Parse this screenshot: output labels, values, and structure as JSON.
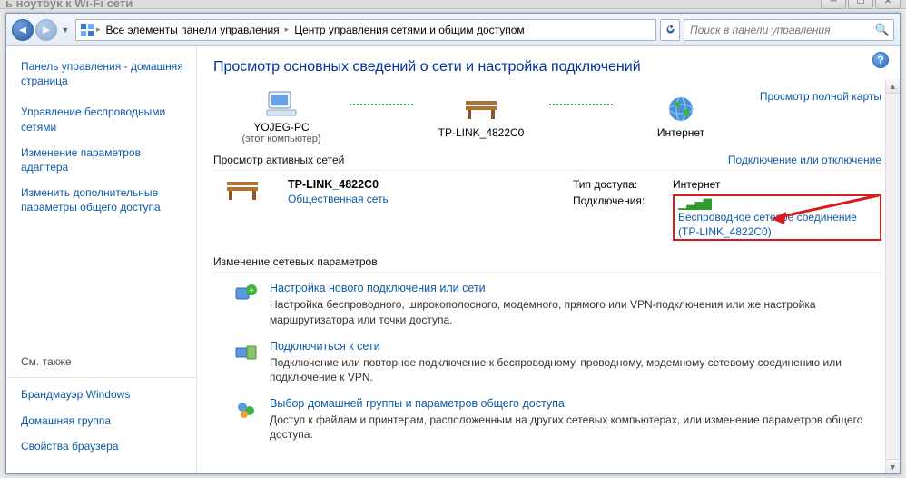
{
  "outer": {
    "partial_title": "ь ноутбук к Wi-Fi сети"
  },
  "addrbar": {
    "bc1": "Все элементы панели управления",
    "bc2": "Центр управления сетями и общим доступом",
    "search_placeholder": "Поиск в панели управления"
  },
  "sidebar": {
    "home": "Панель управления - домашняя страница",
    "items": [
      "Управление беспроводными сетями",
      "Изменение параметров адаптера",
      "Изменить дополнительные параметры общего доступа"
    ],
    "see_also": "См. также",
    "refs": [
      "Брандмауэр Windows",
      "Домашняя группа",
      "Свойства браузера"
    ]
  },
  "content": {
    "heading": "Просмотр основных сведений о сети и настройка подключений",
    "view_map": "Просмотр полной карты",
    "map_nodes": {
      "pc": "YOJEG-PC",
      "pc_sub": "(этот компьютер)",
      "router": "TP-LINK_4822C0",
      "internet": "Интернет"
    },
    "active_title": "Просмотр активных сетей",
    "active_link": "Подключение или отключение",
    "net_name": "TP-LINK_4822C0",
    "net_type": "Общественная сеть",
    "prop_access_label": "Тип доступа:",
    "prop_access_val": "Интернет",
    "prop_conn_label": "Подключения:",
    "prop_conn_link1": "Беспроводное сетевое соединение",
    "prop_conn_link2": "(TP-LINK_4822C0)",
    "change_title": "Изменение сетевых параметров",
    "tasks": [
      {
        "title": "Настройка нового подключения или сети",
        "desc": "Настройка беспроводного, широкополосного, модемного, прямого или VPN-подключения или же настройка маршрутизатора или точки доступа."
      },
      {
        "title": "Подключиться к сети",
        "desc": "Подключение или повторное подключение к беспроводному, проводному, модемному сетевому соединению или подключение к VPN."
      },
      {
        "title": "Выбор домашней группы и параметров общего доступа",
        "desc": "Доступ к файлам и принтерам, расположенным на других сетевых компьютерах, или изменение параметров общего доступа."
      }
    ]
  }
}
